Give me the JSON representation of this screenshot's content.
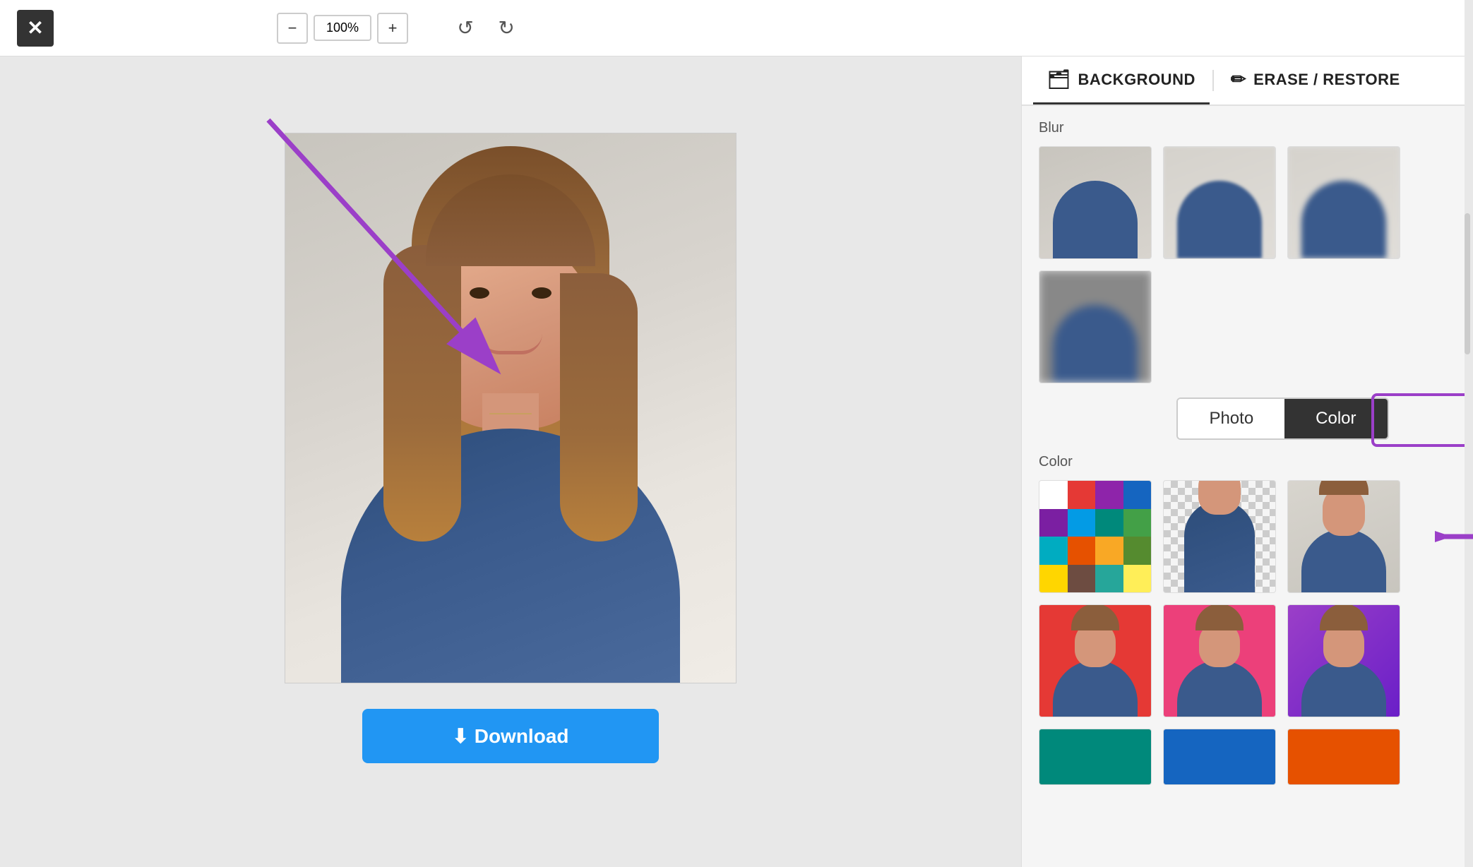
{
  "toolbar": {
    "close_label": "✕",
    "zoom_minus": "−",
    "zoom_value": "100%",
    "zoom_plus": "+",
    "undo_icon": "↺",
    "redo_icon": "↻"
  },
  "tabs": {
    "background_label": "BACKGROUND",
    "background_icon": "🗂",
    "erase_restore_label": "ERASE / RESTORE",
    "erase_icon": "✏"
  },
  "sidebar": {
    "blur_section_label": "Blur",
    "toggle_photo_label": "Photo",
    "toggle_color_label": "Color",
    "color_section_label": "Color",
    "palette_colors": [
      "#ffffff",
      "#e53935",
      "#8e24aa",
      "#1565c0",
      "#7b1fa2",
      "#039be5",
      "#00897b",
      "#43a047",
      "#00acc1",
      "#e65100",
      "#f9a825",
      "#558b2f",
      "#ffd600",
      "#6d4c41",
      "#26a69a",
      "#ffee58"
    ]
  },
  "download": {
    "label": "⬇ Download"
  }
}
